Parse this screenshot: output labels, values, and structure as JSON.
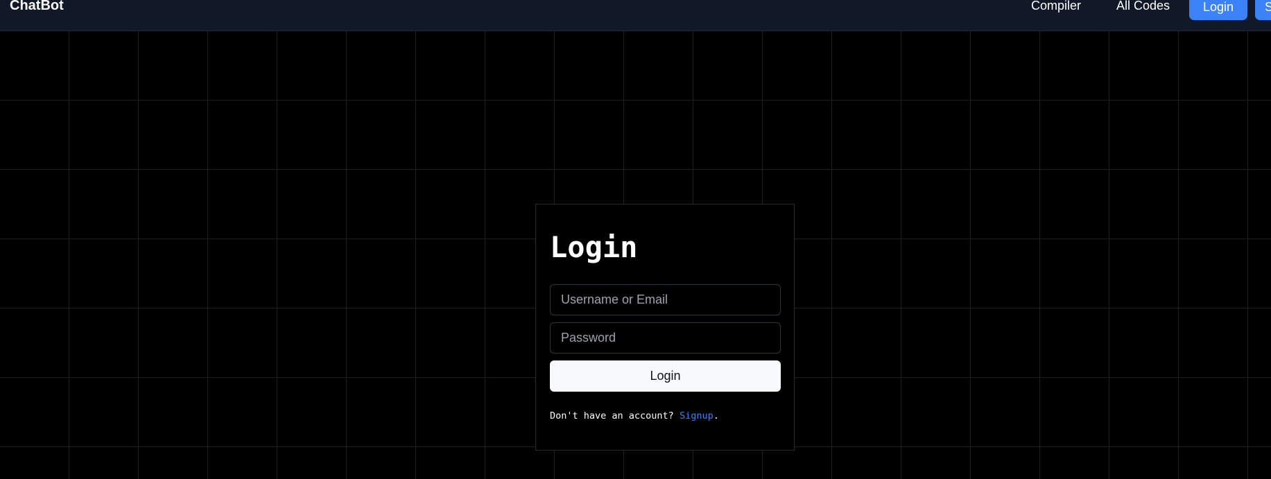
{
  "navbar": {
    "brand": "ChatBot",
    "links": {
      "compiler": "Compiler",
      "all_codes": "All Codes"
    },
    "login_button": "Login",
    "signup_button": "S"
  },
  "login_form": {
    "title": "Login",
    "username": {
      "placeholder": "Username or Email",
      "value": ""
    },
    "password": {
      "placeholder": "Password",
      "value": ""
    },
    "submit_label": "Login",
    "footer_prefix": "Don't have an account? ",
    "signup_link": "Signup",
    "footer_suffix": "."
  },
  "colors": {
    "navbar_bg": "#111827",
    "page_bg": "#000000",
    "accent": "#3b82f6",
    "grid_line": "#1f1f1f"
  }
}
